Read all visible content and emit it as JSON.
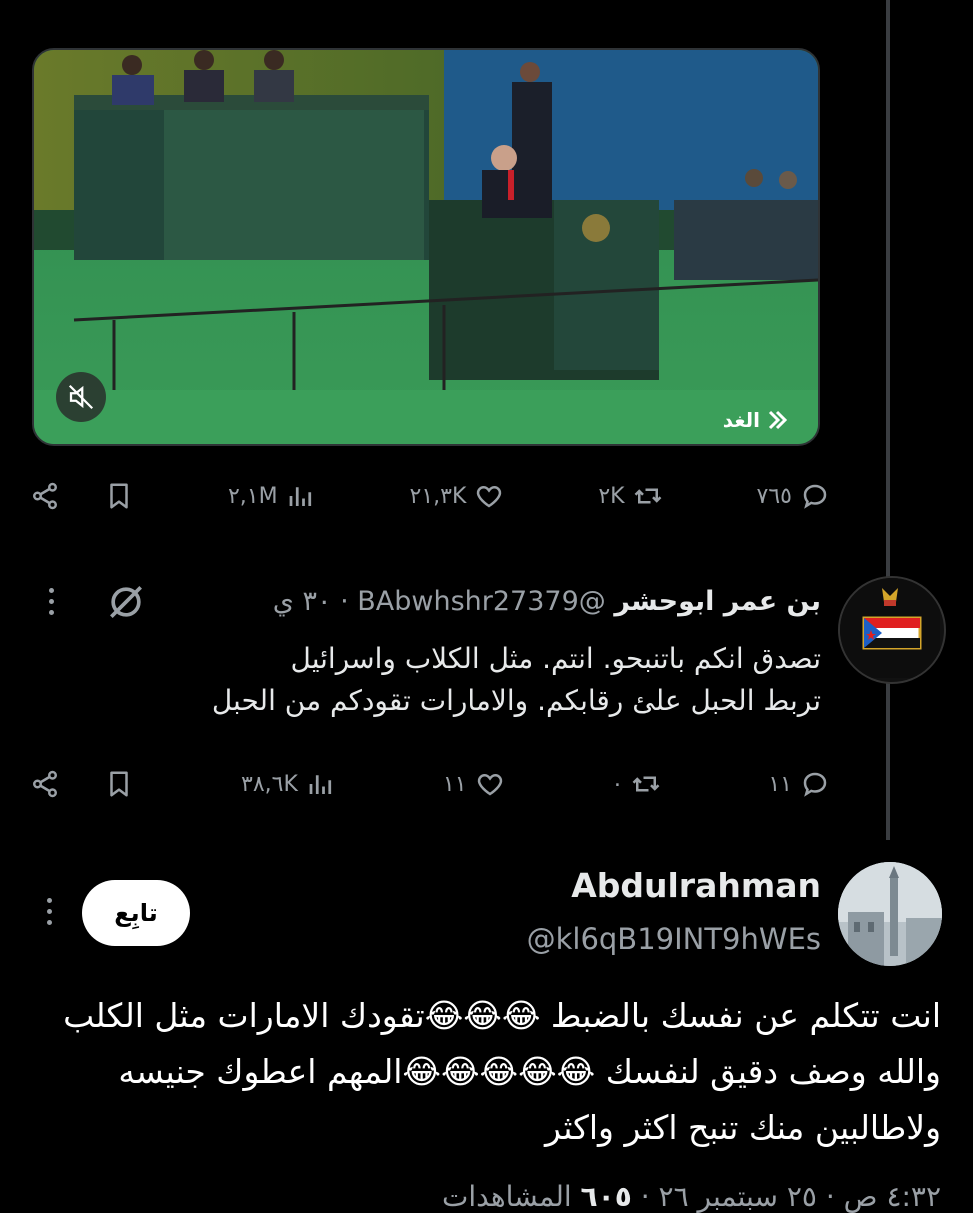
{
  "original_tweet": {
    "media_brand": "الغد",
    "actions": {
      "replies": "٧٦٥",
      "reposts": "٢K",
      "likes": "٢١,٣K",
      "views": "٢,١M"
    }
  },
  "reply": {
    "display_name": "بن عمر ابوحشر",
    "handle": "@BAbwhshr27379",
    "time": "٣٠ ي",
    "text_lines": [
      "تصدق انكم باتنبحو. انتم. مثل الكلاب  واسرائيل",
      "تربط الحبل علئ رقابكم. والامارات تقودكم من الحبل"
    ],
    "actions": {
      "replies": "١١",
      "reposts": "٠",
      "likes": "١١",
      "views": "٣٨,٦K"
    }
  },
  "main_reply": {
    "display_name": "Abdulrahman",
    "handle": "@kl6qB19INT9hWEs",
    "follow_label": "تابِع",
    "text": "انت تتكلم عن نفسك بالضبط 😂😂😂تقودك الامارات مثل الكلب والله وصف دقيق لنفسك 😂😂😂😂😂المهم اعطوك جنيسه ولاطالبين منك تنبح اكثر واكثر",
    "footer": {
      "time": "٤:٣٢ ص",
      "date": "٢٥ سبتمبر ٢٦",
      "views_count": "٦٠٥",
      "views_label": "المشاهدات"
    }
  },
  "colors": {
    "background": "#000000",
    "text": "#e7e9ea",
    "muted": "#9aa0a6"
  }
}
